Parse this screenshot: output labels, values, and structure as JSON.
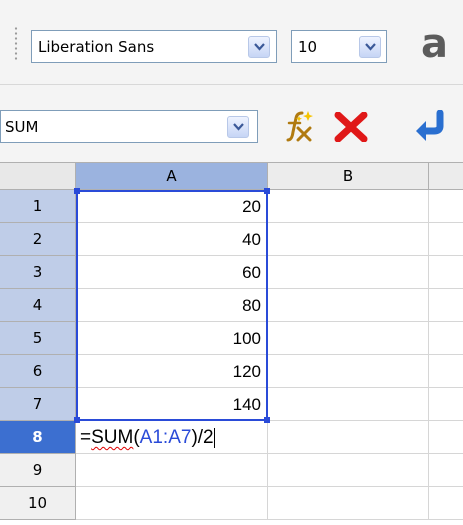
{
  "formatting_toolbar": {
    "font_name": "Liberation Sans",
    "font_size": "10",
    "font_icon_glyph": "a"
  },
  "formula_bar": {
    "name_box": "SUM",
    "icons": [
      "function-wizard-icon",
      "cancel-icon",
      "accept-icon"
    ]
  },
  "sheet": {
    "columns": [
      "A",
      "B"
    ],
    "rows": [
      "1",
      "2",
      "3",
      "4",
      "5",
      "6",
      "7",
      "8",
      "9",
      "10"
    ],
    "column_a_values": [
      "20",
      "40",
      "60",
      "80",
      "100",
      "120",
      "140"
    ],
    "editing_cell": {
      "row": "8",
      "formula_prefix": "=",
      "formula_func": "SUM",
      "formula_open": "(",
      "formula_range": "A1:A7",
      "formula_suffix": ")/2"
    }
  },
  "colors": {
    "selection_border": "#2a4bd8",
    "active_row_header": "#3c6fd0",
    "cancel_red": "#e01818",
    "accept_blue": "#2a6fd0"
  }
}
